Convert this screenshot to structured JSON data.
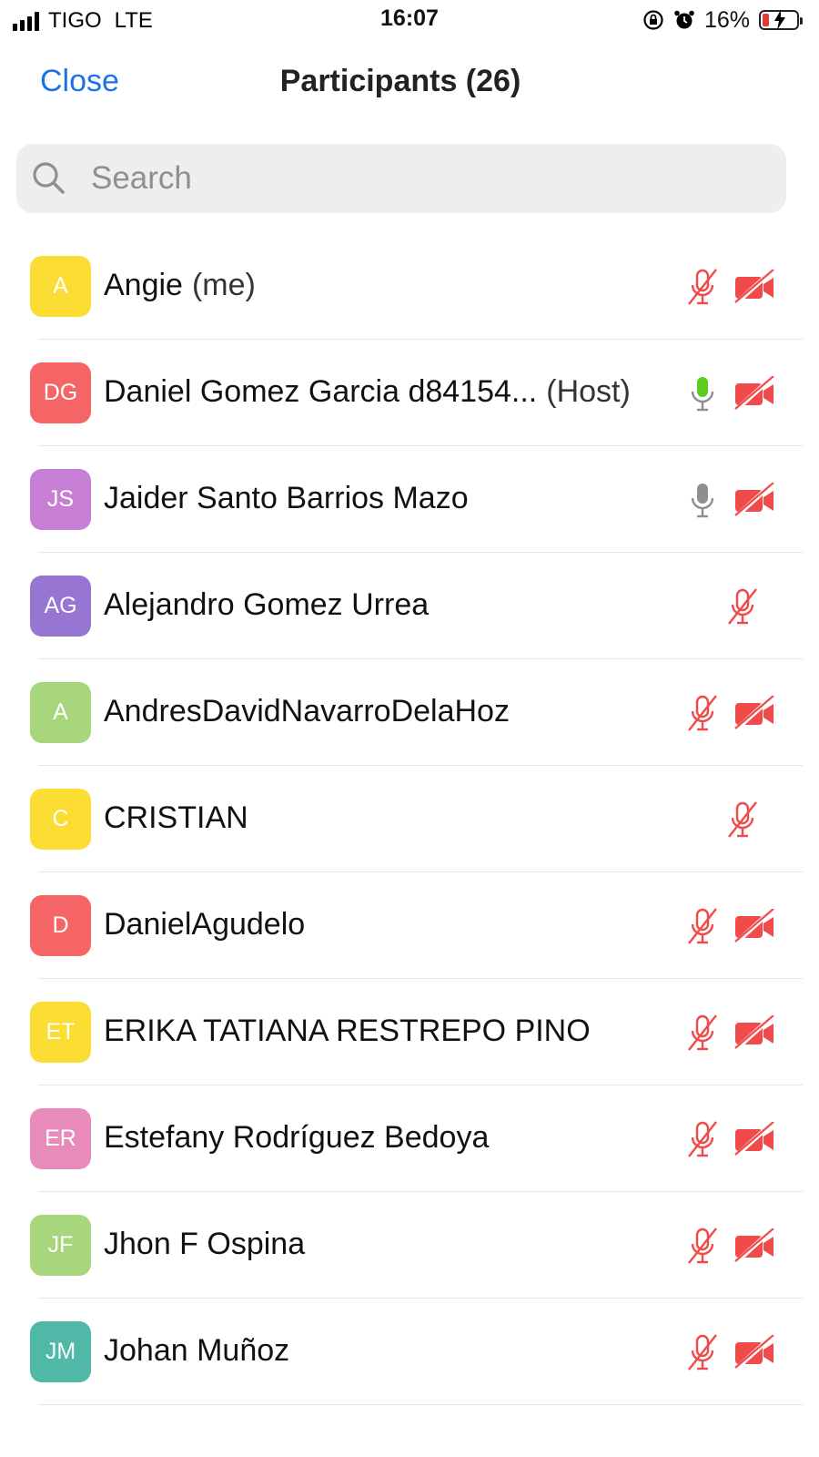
{
  "status_bar": {
    "carrier": "TIGO",
    "network": "LTE",
    "time": "16:07",
    "battery_percent": "16%"
  },
  "header": {
    "close_label": "Close",
    "title": "Participants (26)"
  },
  "search": {
    "placeholder": "Search"
  },
  "colors": {
    "accent": "#1a73e8",
    "muted_red": "#f04a4a",
    "mic_active_green": "#5ccd1f",
    "mic_idle_gray": "#8e8e93"
  },
  "participants": [
    {
      "initials": "A",
      "name": "Angie",
      "tag": "(me)",
      "avatar_color": "#fbdd33",
      "mic": "muted",
      "video": "off"
    },
    {
      "initials": "DG",
      "name": "Daniel Gomez Garcia d84154...",
      "tag": "(Host)",
      "avatar_color": "#f56565",
      "mic": "active",
      "video": "off"
    },
    {
      "initials": "JS",
      "name": "Jaider Santo Barrios Mazo",
      "tag": "",
      "avatar_color": "#c77fd6",
      "mic": "idle",
      "video": "off"
    },
    {
      "initials": "AG",
      "name": "Alejandro Gomez Urrea",
      "tag": "",
      "avatar_color": "#9775d3",
      "mic": "muted",
      "video": "none"
    },
    {
      "initials": "A",
      "name": "AndresDavidNavarroDelaHoz",
      "tag": "",
      "avatar_color": "#a8d67d",
      "mic": "muted",
      "video": "off"
    },
    {
      "initials": "C",
      "name": "CRISTIAN",
      "tag": "",
      "avatar_color": "#fbdd33",
      "mic": "muted",
      "video": "none"
    },
    {
      "initials": "D",
      "name": "DanielAgudelo",
      "tag": "",
      "avatar_color": "#f56565",
      "mic": "muted",
      "video": "off"
    },
    {
      "initials": "ET",
      "name": "ERIKA TATIANA RESTREPO PINO",
      "tag": "",
      "avatar_color": "#fbdd33",
      "mic": "muted",
      "video": "off"
    },
    {
      "initials": "ER",
      "name": "Estefany Rodríguez Bedoya",
      "tag": "",
      "avatar_color": "#e98bba",
      "mic": "muted",
      "video": "off"
    },
    {
      "initials": "JF",
      "name": "Jhon F Ospina",
      "tag": "",
      "avatar_color": "#a8d67d",
      "mic": "muted",
      "video": "off"
    },
    {
      "initials": "JM",
      "name": "Johan Muñoz",
      "tag": "",
      "avatar_color": "#4fb8a6",
      "mic": "muted",
      "video": "off"
    }
  ]
}
